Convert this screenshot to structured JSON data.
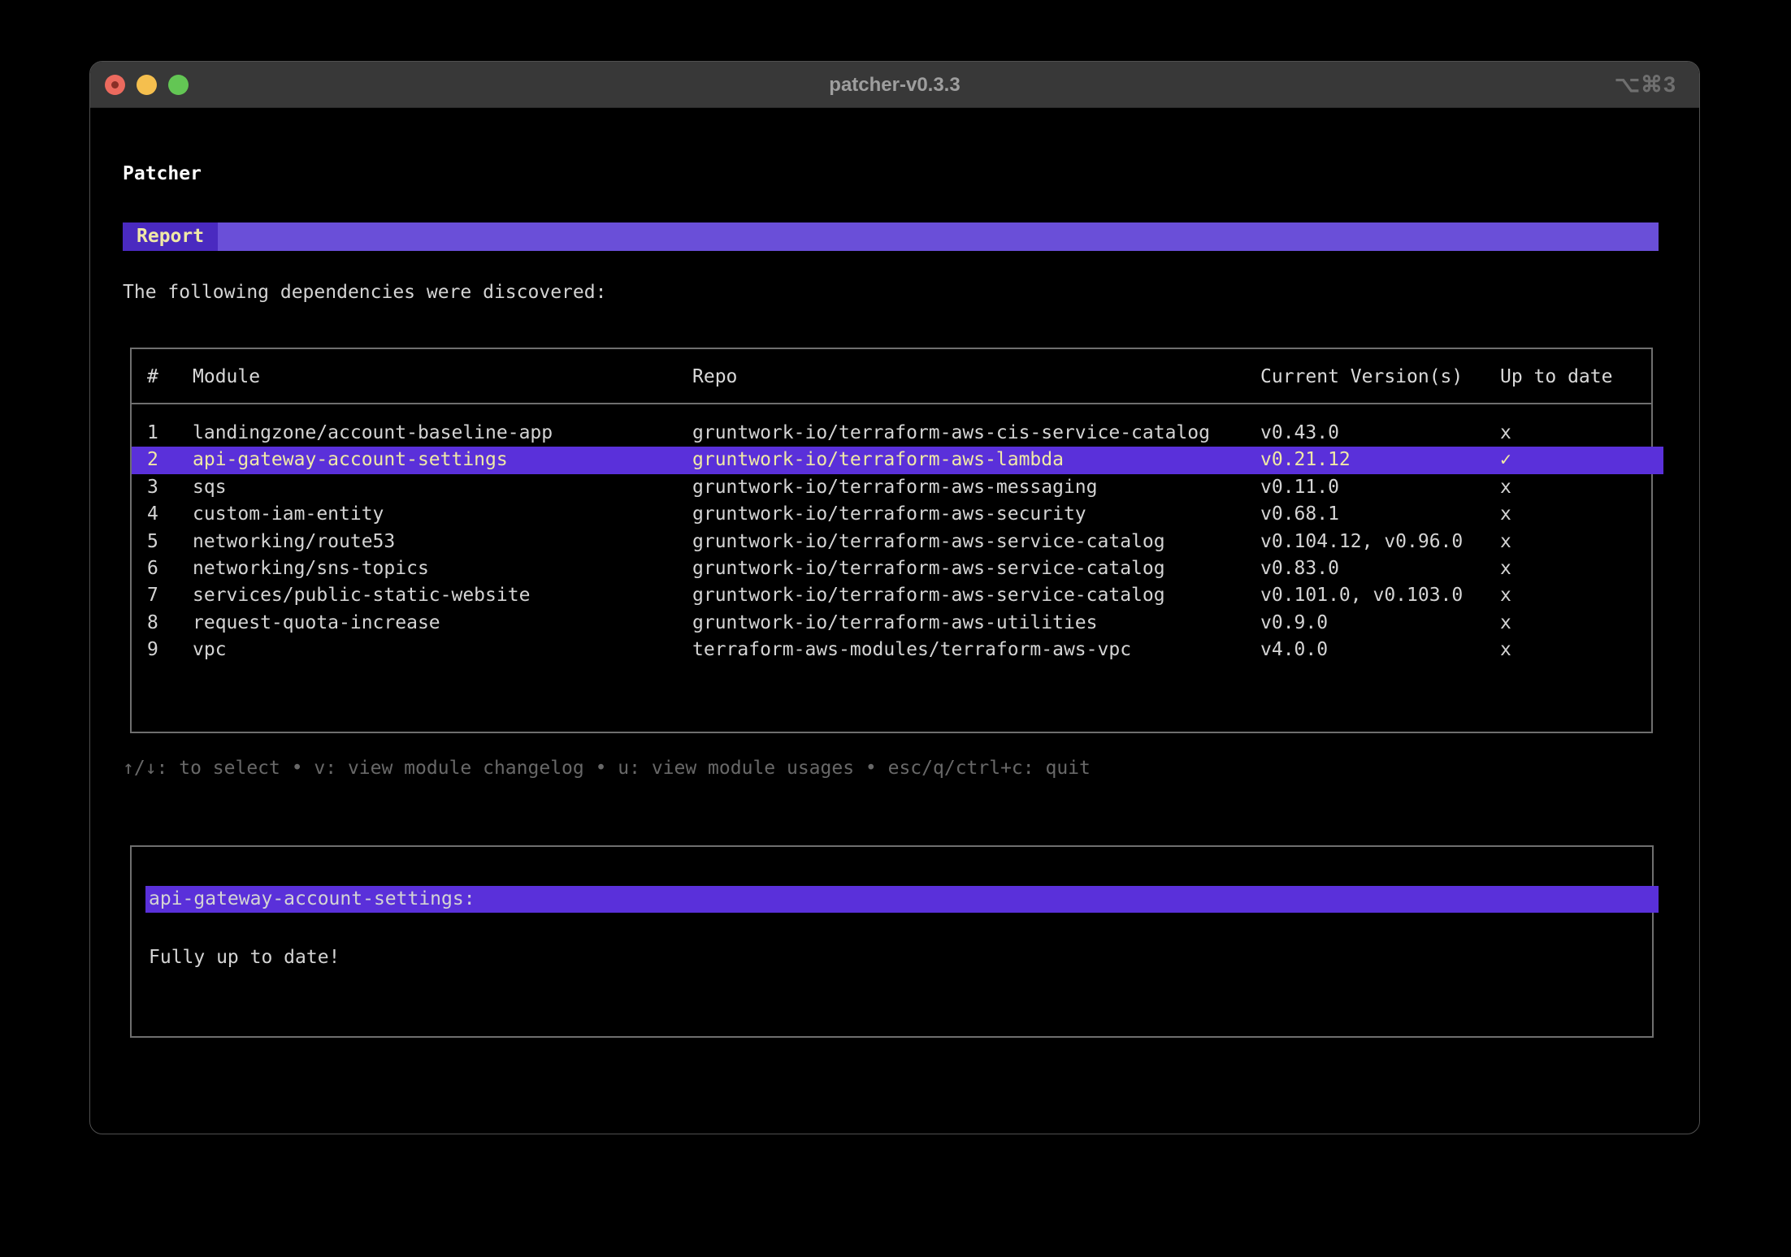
{
  "window": {
    "title": "patcher-v0.3.3",
    "shortcut": "⌥⌘3"
  },
  "app": {
    "heading": "Patcher",
    "tab_label": "Report",
    "intro": "The following dependencies were discovered:"
  },
  "table": {
    "headers": {
      "num": "#",
      "module": "Module",
      "repo": "Repo",
      "version": "Current Version(s)",
      "status": "Up to date"
    },
    "rows": [
      {
        "num": "1",
        "module": "landingzone/account-baseline-app",
        "repo": "gruntwork-io/terraform-aws-cis-service-catalog",
        "version": "v0.43.0",
        "status": "x",
        "selected": false
      },
      {
        "num": "2",
        "module": "api-gateway-account-settings",
        "repo": "gruntwork-io/terraform-aws-lambda",
        "version": "v0.21.12",
        "status": "✓",
        "selected": true
      },
      {
        "num": "3",
        "module": "sqs",
        "repo": "gruntwork-io/terraform-aws-messaging",
        "version": "v0.11.0",
        "status": "x",
        "selected": false
      },
      {
        "num": "4",
        "module": "custom-iam-entity",
        "repo": "gruntwork-io/terraform-aws-security",
        "version": "v0.68.1",
        "status": "x",
        "selected": false
      },
      {
        "num": "5",
        "module": "networking/route53",
        "repo": "gruntwork-io/terraform-aws-service-catalog",
        "version": "v0.104.12, v0.96.0",
        "status": "x",
        "selected": false
      },
      {
        "num": "6",
        "module": "networking/sns-topics",
        "repo": "gruntwork-io/terraform-aws-service-catalog",
        "version": "v0.83.0",
        "status": "x",
        "selected": false
      },
      {
        "num": "7",
        "module": "services/public-static-website",
        "repo": "gruntwork-io/terraform-aws-service-catalog",
        "version": "v0.101.0, v0.103.0",
        "status": "x",
        "selected": false
      },
      {
        "num": "8",
        "module": "request-quota-increase",
        "repo": "gruntwork-io/terraform-aws-utilities",
        "version": "v0.9.0",
        "status": "x",
        "selected": false
      },
      {
        "num": "9",
        "module": "vpc",
        "repo": "terraform-aws-modules/terraform-aws-vpc",
        "version": "v4.0.0",
        "status": "x",
        "selected": false
      }
    ]
  },
  "help": {
    "text": "↑/↓: to select • v: view module changelog • u: view module usages • esc/q/ctrl+c: quit"
  },
  "detail": {
    "title": "api-gateway-account-settings:",
    "body": "Fully up to date!"
  },
  "colors": {
    "accent_bar": "#6a4fd8",
    "accent_tab": "#4a2ac0",
    "selection": "#5a30da",
    "selection_text": "#f0e9a6",
    "text": "#d4d4d4",
    "muted": "#686868",
    "border": "#6f6f6f",
    "titlebar": "#383838",
    "close_red": "#ec6a5e",
    "minimize_yellow": "#f5bf4e",
    "zoom_green": "#63c654"
  }
}
